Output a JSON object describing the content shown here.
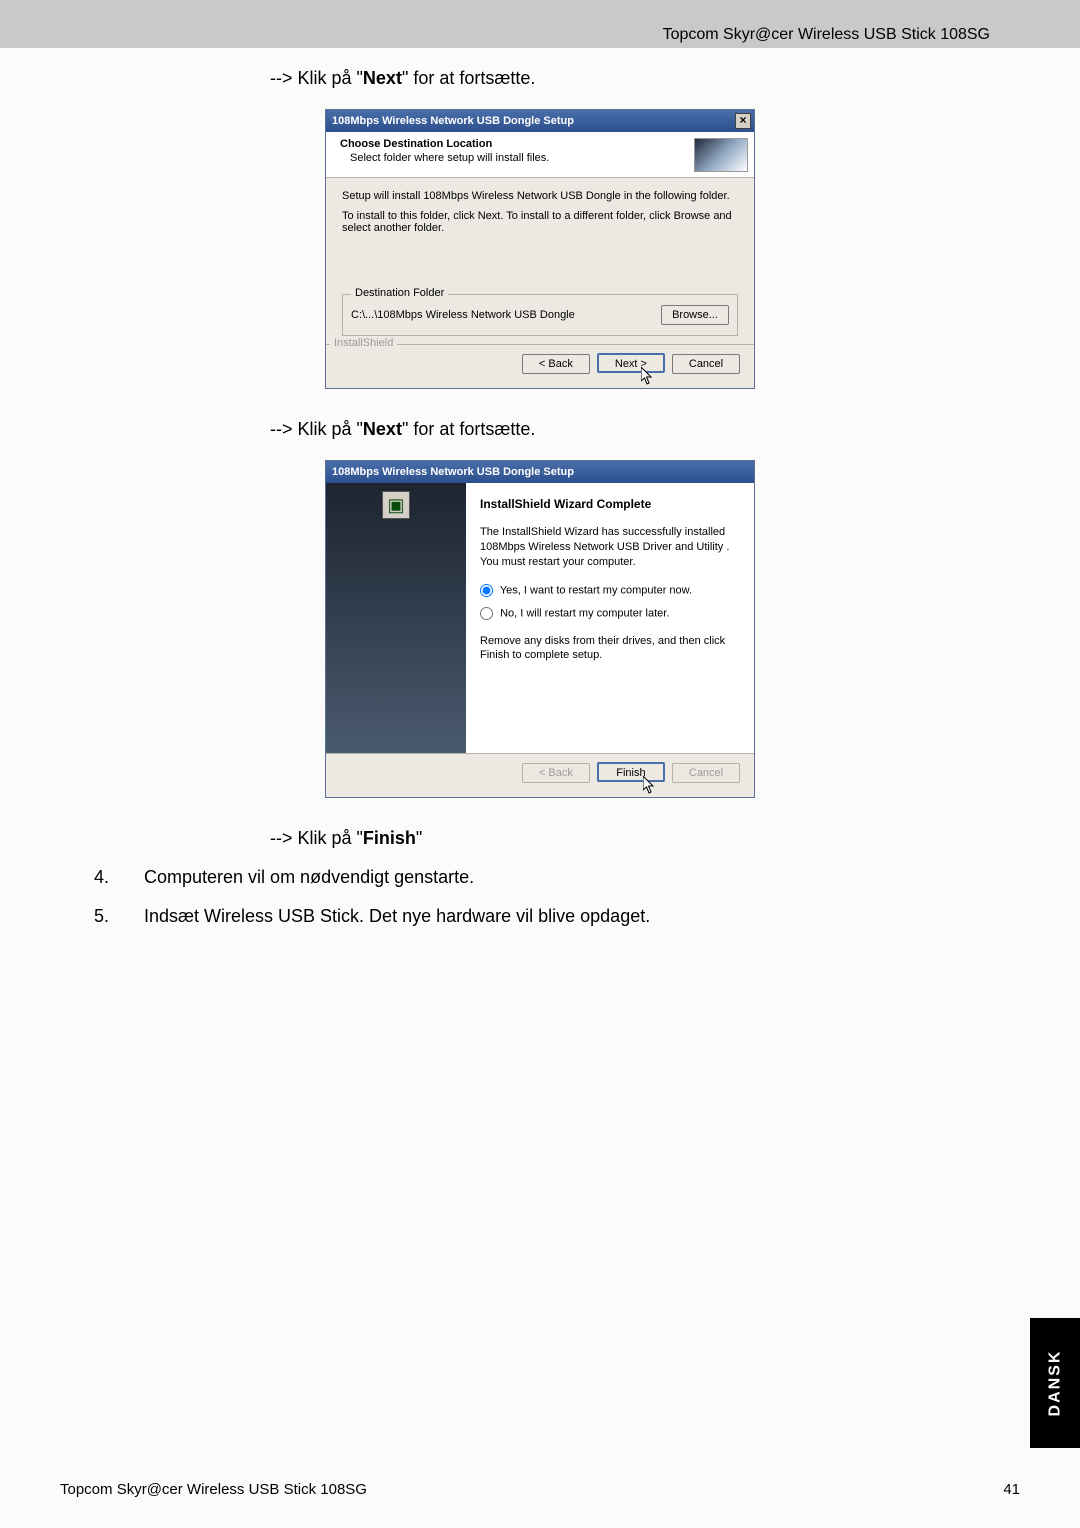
{
  "header": {
    "product": "Topcom Skyr@cer Wireless USB Stick 108SG"
  },
  "instr1": {
    "prefix": "--> Klik på \"",
    "bold": "Next",
    "suffix": "\" for at fortsætte."
  },
  "instr2": {
    "prefix": "--> Klik på \"",
    "bold": "Next",
    "suffix": "\" for at fortsætte."
  },
  "instr3": {
    "prefix": "--> Klik på \"",
    "bold": "Finish",
    "suffix": "\""
  },
  "dialog1": {
    "title": "108Mbps Wireless Network USB Dongle Setup",
    "header_title": "Choose Destination Location",
    "header_sub": "Select folder where setup will install files.",
    "body_line1": "Setup will install 108Mbps Wireless Network USB Dongle in the following folder.",
    "body_line2": "To install to this folder, click Next. To install to a different folder, click Browse and select another folder.",
    "dest_legend": "Destination Folder",
    "dest_path": "C:\\...\\108Mbps Wireless Network USB Dongle",
    "browse": "Browse...",
    "installshield": "InstallShield",
    "back": "< Back",
    "next": "Next >",
    "cancel": "Cancel"
  },
  "dialog2": {
    "title": "108Mbps Wireless Network USB Dongle Setup",
    "heading": "InstallShield Wizard Complete",
    "para1": "The InstallShield Wizard has successfully installed 108Mbps Wireless Network USB Driver and Utility . You must restart your computer.",
    "opt_yes": "Yes, I want to restart my computer now.",
    "opt_no": "No, I will restart my computer later.",
    "para2": "Remove any disks from their drives, and then click Finish to complete setup.",
    "back": "< Back",
    "finish": "Finish",
    "cancel": "Cancel"
  },
  "steps": {
    "s4_num": "4.",
    "s4_text": "Computeren vil om nødvendigt genstarte.",
    "s5_num": "5.",
    "s5_text": "Indsæt Wireless USB Stick. Det nye hardware vil blive opdaget."
  },
  "footer": {
    "left": "Topcom Skyr@cer Wireless USB Stick 108SG",
    "page": "41"
  },
  "side_tab": "DANSK"
}
